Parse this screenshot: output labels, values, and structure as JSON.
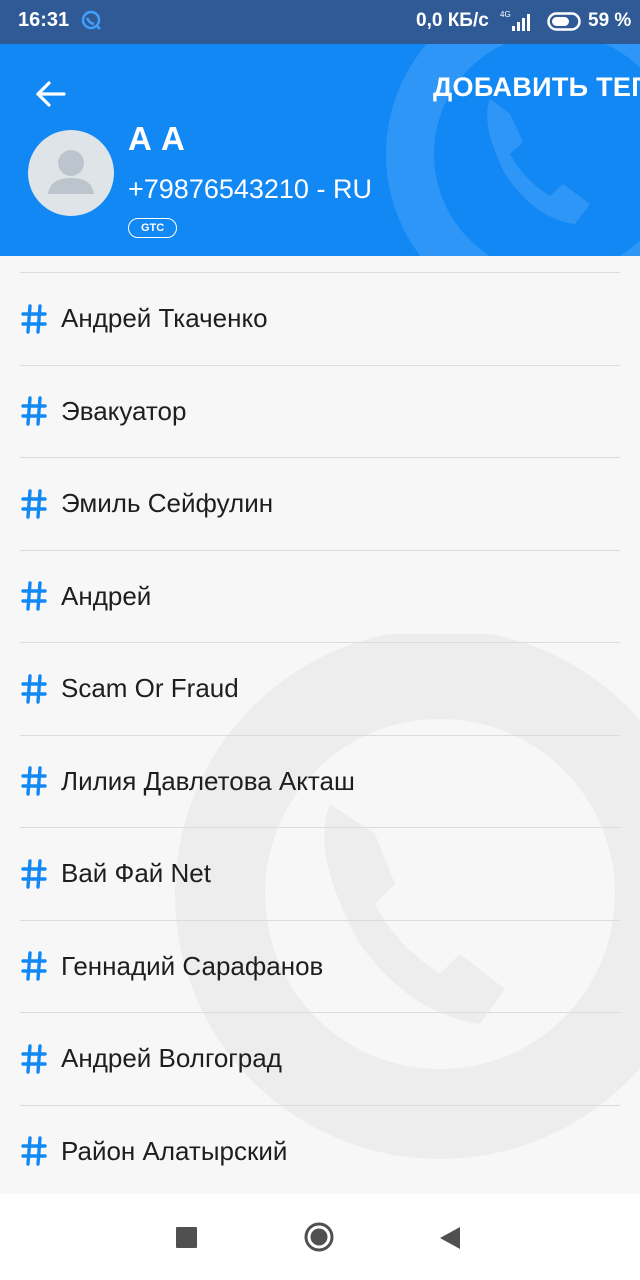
{
  "status_bar": {
    "time": "16:31",
    "network_speed": "0,0 КБ/с",
    "network_type": "4G",
    "battery_percent": "59 %"
  },
  "header": {
    "add_tag_label": "ДОБАВИТЬ ТЕГ",
    "contact_name": "А А",
    "contact_phone": "+79876543210 - RU",
    "operator_badge": "GTC",
    "back_icon": "arrow-left-icon",
    "accent_color": "#1288f5"
  },
  "tags": [
    {
      "label": "Андрей Ткаченко"
    },
    {
      "label": "Эвакуатор"
    },
    {
      "label": "Эмиль Сейфулин"
    },
    {
      "label": "Андрей"
    },
    {
      "label": "Scam Or Fraud"
    },
    {
      "label": "Лилия Давлетова Акташ"
    },
    {
      "label": "Вай Фай Net"
    },
    {
      "label": "Геннадий Сарафанов"
    },
    {
      "label": "Андрей Волгоград"
    },
    {
      "label": "Район Алатырский"
    }
  ],
  "tag_icon": "hashtag-icon",
  "nav_bar": {
    "recent_icon": "square-icon",
    "home_icon": "circle-icon",
    "back_icon": "triangle-back-icon"
  }
}
